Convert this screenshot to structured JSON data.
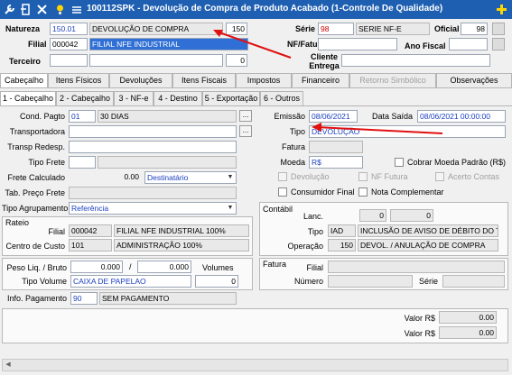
{
  "window": {
    "title": "100112SPK - Devolução de Compra de Produto Acabado (1-Controle De Qualidade)"
  },
  "header": {
    "natureza_label": "Natureza",
    "natureza_code": "150.01",
    "natureza_desc": "DEVOLUÇÃO DE COMPRA",
    "natureza_num": "150",
    "serie_label": "Série",
    "serie_code": "98",
    "serie_desc": "SERIE NF-E",
    "oficial_label": "Oficial",
    "oficial_value": "98",
    "filial_label": "Filial",
    "filial_code": "000042",
    "filial_desc": "FILIAL NFE INDUSTRIAL",
    "nffatura_label": "NF/Fatura",
    "anofiscal_label": "Ano Fiscal",
    "terceiro_label": "Terceiro",
    "terceiro_num": "0",
    "cliente_entrega_label": "Cliente Entrega"
  },
  "tabs": [
    "Cabeçalho",
    "Itens Físicos",
    "Devoluções",
    "Itens Fiscais",
    "Impostos",
    "Financeiro",
    "Retorno Simbólico",
    "Observações"
  ],
  "subtabs": [
    "1 - Cabeçalho",
    "2 - Cabeçalho",
    "3 - NF-e",
    "4 - Destino",
    "5 - Exportação",
    "6 - Outros"
  ],
  "left": {
    "cond_pagto_label": "Cond. Pagto",
    "cond_pagto_code": "01",
    "cond_pagto_desc": "30 DIAS",
    "transportadora_label": "Transportadora",
    "transp_redesp_label": "Transp Redesp.",
    "tipo_frete_label": "Tipo Frete",
    "frete_calculado_label": "Frete Calculado",
    "frete_calculado_value": "0.00",
    "frete_dest": "Destinatário",
    "tab_preco_frete_label": "Tab. Preço Frete",
    "tipo_agrupamento_label": "Tipo Agrupamento",
    "tipo_agrupamento_value": "Referência",
    "rateio_title": "Rateio",
    "rateio_filial_label": "Filial",
    "rateio_filial_code": "000042",
    "rateio_filial_desc": "FILIAL NFE INDUSTRIAL 100%",
    "centro_custo_label": "Centro de Custo",
    "centro_custo_code": "101",
    "centro_custo_desc": "ADMINISTRAÇÃO 100%",
    "peso_label": "Peso Liq. / Bruto",
    "peso_liq": "0.000",
    "peso_sep": "/",
    "peso_bruto": "0.000",
    "volumes_label": "Volumes",
    "tipo_volume_label": "Tipo Volume",
    "tipo_volume_value": "CAIXA DE PAPELAO",
    "volume_count": "0",
    "info_pagamento_label": "Info. Pagamento",
    "info_pagamento_code": "90",
    "info_pagamento_desc": "SEM PAGAMENTO"
  },
  "right": {
    "emissao_label": "Emissão",
    "emissao_value": "08/06/2021",
    "data_saida_label": "Data Saída",
    "data_saida_value": "08/06/2021 00:00:00",
    "tipo_label": "Tipo",
    "tipo_value": "DEVOLUÇÃO",
    "fatura_label": "Fatura",
    "moeda_label": "Moeda",
    "moeda_value": "R$",
    "cobrar_moeda_label": "Cobrar Moeda Padrão (R$)",
    "devolucao_label": "Devolução",
    "nf_futura_label": "NF Futura",
    "acerto_contas_label": "Acerto Contas",
    "consumidor_final_label": "Consumidor Final",
    "nota_complementar_label": "Nota Complementar",
    "contabil_title": "Contábil",
    "lanc_label": "Lanc.",
    "lanc_a": "0",
    "lanc_b": "0",
    "tipo2_label": "Tipo",
    "tipo2_code": "IAD",
    "tipo2_desc": "INCLUSÃO DE AVISO DE DÉBITO DO TE",
    "operacao_label": "Operação",
    "operacao_code": "150",
    "operacao_desc": "DEVOL. / ANULAÇÃO DE COMPRA",
    "fatura2_title": "Fatura",
    "filial_label": "Filial",
    "numero_label": "Número",
    "serie_label": "Série"
  },
  "bottom": {
    "valor1_label": "Valor R$",
    "valor1": "0.00",
    "valor2_label": "Valor R$",
    "valor2": "0.00"
  },
  "colors": {
    "titlebar": "#1e5fb1",
    "arrow": "#e01010",
    "accent_blue": "#1a3fc0",
    "required_red": "#d00000"
  }
}
